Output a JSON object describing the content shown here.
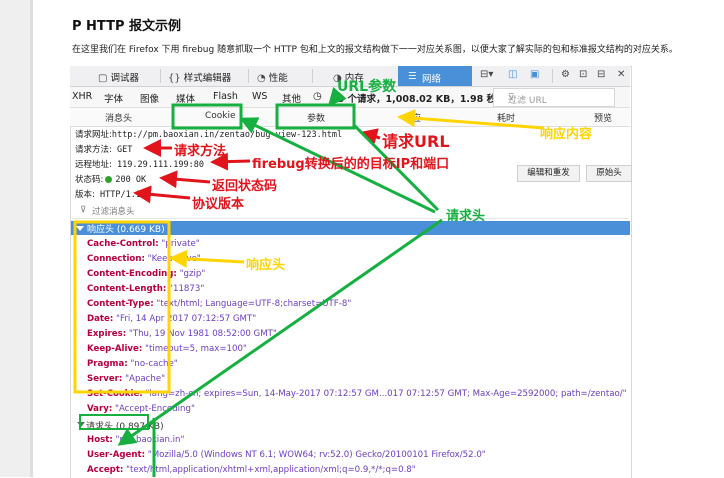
{
  "article": {
    "heading": "P HTTP  报文示例",
    "intro": "在这里我们在 Firefox 下用 firebug 随意抓取一个 HTTP 包和上文的报文结构做下一一对应关系图，以便大家了解实际的包和标准报文结构的对应关系。"
  },
  "devtools": {
    "toolbar": {
      "debugger": "调试器",
      "style_editor": "样式编辑器",
      "performance": "性能",
      "memory": "内存",
      "network": "网络",
      "close": "✕"
    },
    "filters": [
      "XHR",
      "字体",
      "图像",
      "媒体",
      "Flash",
      "WS",
      "其他"
    ],
    "summary": "13 个请求，1,008.02 KB，1.98 秒",
    "filter_url_placeholder": "过滤 URL",
    "tabs": [
      "消息头",
      "Cookie",
      "参数",
      "响应",
      "耗时",
      "预览"
    ],
    "request": {
      "url_label": "请求网址:",
      "url": "http://pm.baoxian.in/zentao/bug-view-123.html",
      "method_label": "请求方法:",
      "method": "GET",
      "remote_label": "远程地址:",
      "remote": "119.29.111.199:80",
      "status_label": "状态码:",
      "status": "200 OK",
      "version_label": "版本:",
      "version": "HTTP/1.1"
    },
    "buttons": {
      "edit_resend": "编辑和重发",
      "raw_headers": "原始头"
    },
    "filter_headers_placeholder": "过滤消息头",
    "response_headers_title": "响应头 (0.669 KB)",
    "response_headers": [
      {
        "key": "Cache-Control:",
        "value": "\"private\""
      },
      {
        "key": "Connection:",
        "value": "\"Keep-Alive\""
      },
      {
        "key": "Content-Encoding:",
        "value": "\"gzip\""
      },
      {
        "key": "Content-Length:",
        "value": "\"11873\""
      },
      {
        "key": "Content-Type:",
        "value": "\"text/html; Language=UTF-8;charset=UTF-8\""
      },
      {
        "key": "Date:",
        "value": "\"Fri, 14 Apr 2017 07:12:57 GMT\""
      },
      {
        "key": "Expires:",
        "value": "\"Thu, 19 Nov 1981 08:52:00 GMT\""
      },
      {
        "key": "Keep-Alive:",
        "value": "\"timeout=5, max=100\""
      },
      {
        "key": "Pragma:",
        "value": "\"no-cache\""
      },
      {
        "key": "Server:",
        "value": "\"Apache\""
      },
      {
        "key": "Set-Cookie:",
        "value": "\"lang=zh-cn; expires=Sun, 14-May-2017 07:12:57 GM...017 07:12:57 GMT; Max-Age=2592000; path=/zentao/\""
      },
      {
        "key": "Vary:",
        "value": "\"Accept-Encoding\""
      }
    ],
    "request_headers_title": "请求头 (0.897 KB)",
    "request_headers": [
      {
        "key": "Host:",
        "value": "\"pm.baoxian.in\""
      },
      {
        "key": "User-Agent:",
        "value": "\"Mozilla/5.0 (Windows NT 6.1; WOW64; rv:52.0) Gecko/20100101 Firefox/52.0\""
      },
      {
        "key": "Accept:",
        "value": "\"text/html,application/xhtml+xml,application/xml;q=0.9,*/*;q=0.8\""
      }
    ]
  },
  "annotations": {
    "url_params": "URL参数",
    "response_content": "响应内容",
    "request_url": "请求URL",
    "request_method": "请求方法",
    "target_ip_port": "firebug转换后的的目标IP和端口",
    "status_code": "返回状态码",
    "protocol_version": "协议版本",
    "request_headers": "请求头",
    "response_headers": "响应头"
  },
  "colors": {
    "red": "#e0141a",
    "yellow": "#ffd400",
    "green": "#15b040",
    "selected_blue": "#4a90d9"
  }
}
